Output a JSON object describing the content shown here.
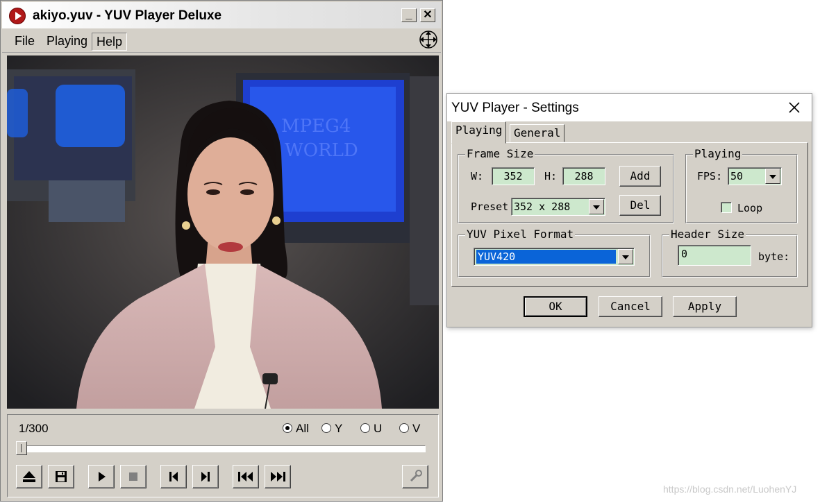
{
  "player": {
    "title": "akiyo.yuv - YUV Player Deluxe",
    "minimize_glyph": "_",
    "close_glyph": "✕",
    "menu": [
      {
        "label": "File"
      },
      {
        "label": "Playing"
      },
      {
        "label": "Help"
      }
    ],
    "frame_counter": "1/300",
    "planes": [
      {
        "label": "All",
        "selected": true
      },
      {
        "label": "Y",
        "selected": false
      },
      {
        "label": "U",
        "selected": false
      },
      {
        "label": "V",
        "selected": false
      }
    ],
    "progress_fraction": 0.0,
    "buttons": [
      "eject-icon",
      "save-icon",
      "play-icon",
      "stop-icon",
      "prev-frame-icon",
      "next-frame-icon",
      "first-frame-icon",
      "last-frame-icon",
      "wrench-icon"
    ]
  },
  "settings": {
    "title": "YUV Player - Settings",
    "tabs": [
      {
        "label": "Playing",
        "active": true
      },
      {
        "label": "General",
        "active": false
      }
    ],
    "frame_size": {
      "group_label": "Frame Size",
      "w_label": "W:",
      "w_value": "352",
      "h_label": "H:",
      "h_value": "288",
      "add_label": "Add",
      "preset_label": "Preset",
      "preset_value": "352 x 288",
      "del_label": "Del"
    },
    "playing": {
      "group_label": "Playing",
      "fps_label": "FPS:",
      "fps_value": "50",
      "loop_label": "Loop",
      "loop_checked": false
    },
    "pixel_format": {
      "group_label": "YUV Pixel Format",
      "value": "YUV420"
    },
    "header_size": {
      "group_label": "Header Size",
      "value": "0",
      "unit": "byte:"
    },
    "ok_label": "OK",
    "cancel_label": "Cancel",
    "apply_label": "Apply"
  },
  "watermark": "https://blog.csdn.net/LuohenYJ",
  "colors": {
    "window_face": "#d4d0c8",
    "field_green": "#cde8cd",
    "selection_blue": "#0a64d8"
  }
}
